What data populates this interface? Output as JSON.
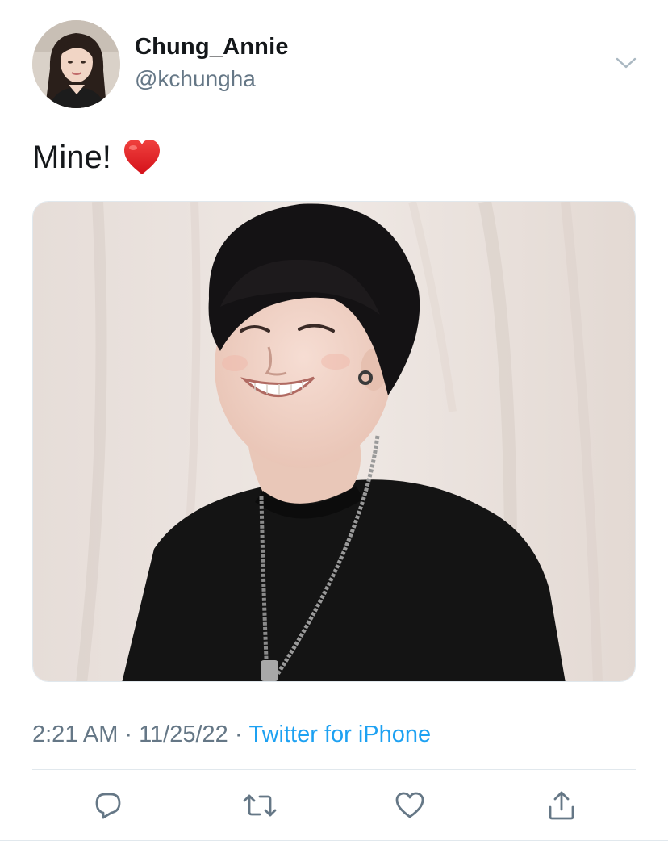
{
  "user": {
    "display_name": "Chung_Annie",
    "handle": "@kchungha",
    "avatar_icon": "profile-photo"
  },
  "tweet": {
    "text": "Mine!",
    "emoji": "red-heart",
    "media_description_icon": "photo"
  },
  "meta": {
    "time": "2:21 AM",
    "separator": "·",
    "date": "11/25/22",
    "source": "Twitter for iPhone"
  },
  "actions": {
    "reply_icon": "reply-icon",
    "retweet_icon": "retweet-icon",
    "like_icon": "like-icon",
    "share_icon": "share-icon"
  },
  "colors": {
    "text": "#14171a",
    "secondary": "#657786",
    "accent": "#1da1f2",
    "divider": "#e1e8ed"
  }
}
